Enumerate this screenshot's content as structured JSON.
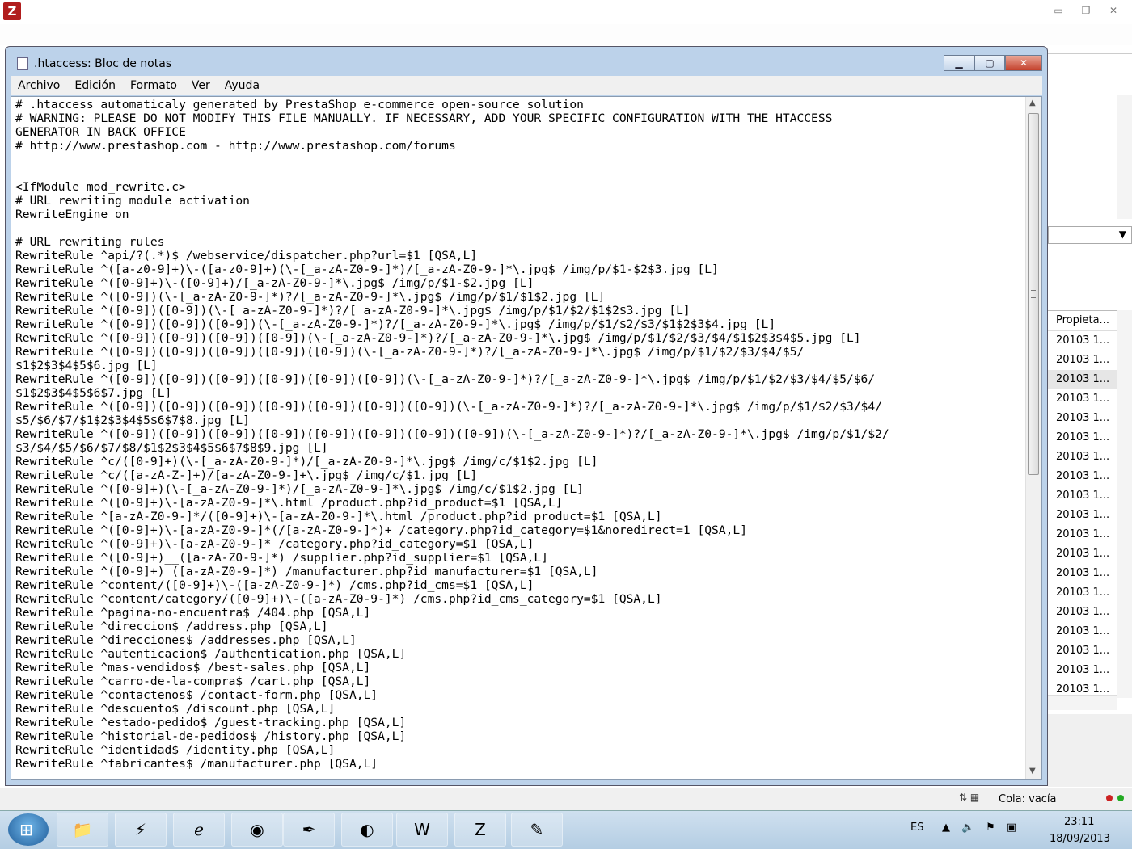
{
  "notepad": {
    "title": ".htaccess: Bloc de notas",
    "menu": [
      "Archivo",
      "Edición",
      "Formato",
      "Ver",
      "Ayuda"
    ],
    "content": "# .htaccess automaticaly generated by PrestaShop e-commerce open-source solution\n# WARNING: PLEASE DO NOT MODIFY THIS FILE MANUALLY. IF NECESSARY, ADD YOUR SPECIFIC CONFIGURATION WITH THE HTACCESS\nGENERATOR IN BACK OFFICE\n# http://www.prestashop.com - http://www.prestashop.com/forums\n\n\n<IfModule mod_rewrite.c>\n# URL rewriting module activation\nRewriteEngine on\n\n# URL rewriting rules\nRewriteRule ^api/?(.*)$ /webservice/dispatcher.php?url=$1 [QSA,L]\nRewriteRule ^([a-z0-9]+)\\-([a-z0-9]+)(\\-[_a-zA-Z0-9-]*)/[_a-zA-Z0-9-]*\\.jpg$ /img/p/$1-$2$3.jpg [L]\nRewriteRule ^([0-9]+)\\-([0-9]+)/[_a-zA-Z0-9-]*\\.jpg$ /img/p/$1-$2.jpg [L]\nRewriteRule ^([0-9])(\\-[_a-zA-Z0-9-]*)?/[_a-zA-Z0-9-]*\\.jpg$ /img/p/$1/$1$2.jpg [L]\nRewriteRule ^([0-9])([0-9])(\\-[_a-zA-Z0-9-]*)?/[_a-zA-Z0-9-]*\\.jpg$ /img/p/$1/$2/$1$2$3.jpg [L]\nRewriteRule ^([0-9])([0-9])([0-9])(\\-[_a-zA-Z0-9-]*)?/[_a-zA-Z0-9-]*\\.jpg$ /img/p/$1/$2/$3/$1$2$3$4.jpg [L]\nRewriteRule ^([0-9])([0-9])([0-9])([0-9])(\\-[_a-zA-Z0-9-]*)?/[_a-zA-Z0-9-]*\\.jpg$ /img/p/$1/$2/$3/$4/$1$2$3$4$5.jpg [L]\nRewriteRule ^([0-9])([0-9])([0-9])([0-9])([0-9])(\\-[_a-zA-Z0-9-]*)?/[_a-zA-Z0-9-]*\\.jpg$ /img/p/$1/$2/$3/$4/$5/\n$1$2$3$4$5$6.jpg [L]\nRewriteRule ^([0-9])([0-9])([0-9])([0-9])([0-9])([0-9])(\\-[_a-zA-Z0-9-]*)?/[_a-zA-Z0-9-]*\\.jpg$ /img/p/$1/$2/$3/$4/$5/$6/\n$1$2$3$4$5$6$7.jpg [L]\nRewriteRule ^([0-9])([0-9])([0-9])([0-9])([0-9])([0-9])([0-9])(\\-[_a-zA-Z0-9-]*)?/[_a-zA-Z0-9-]*\\.jpg$ /img/p/$1/$2/$3/$4/\n$5/$6/$7/$1$2$3$4$5$6$7$8.jpg [L]\nRewriteRule ^([0-9])([0-9])([0-9])([0-9])([0-9])([0-9])([0-9])([0-9])(\\-[_a-zA-Z0-9-]*)?/[_a-zA-Z0-9-]*\\.jpg$ /img/p/$1/$2/\n$3/$4/$5/$6/$7/$8/$1$2$3$4$5$6$7$8$9.jpg [L]\nRewriteRule ^c/([0-9]+)(\\-[_a-zA-Z0-9-]*)/[_a-zA-Z0-9-]*\\.jpg$ /img/c/$1$2.jpg [L]\nRewriteRule ^c/([a-zA-Z-]+)/[a-zA-Z0-9-]+\\.jpg$ /img/c/$1.jpg [L]\nRewriteRule ^([0-9]+)(\\-[_a-zA-Z0-9-]*)/[_a-zA-Z0-9-]*\\.jpg$ /img/c/$1$2.jpg [L]\nRewriteRule ^([0-9]+)\\-[a-zA-Z0-9-]*\\.html /product.php?id_product=$1 [QSA,L]\nRewriteRule ^[a-zA-Z0-9-]*/([0-9]+)\\-[a-zA-Z0-9-]*\\.html /product.php?id_product=$1 [QSA,L]\nRewriteRule ^([0-9]+)\\-[a-zA-Z0-9-]*(/[a-zA-Z0-9-]*)+ /category.php?id_category=$1&noredirect=1 [QSA,L]\nRewriteRule ^([0-9]+)\\-[a-zA-Z0-9-]* /category.php?id_category=$1 [QSA,L]\nRewriteRule ^([0-9]+)__([a-zA-Z0-9-]*) /supplier.php?id_supplier=$1 [QSA,L]\nRewriteRule ^([0-9]+)_([a-zA-Z0-9-]*) /manufacturer.php?id_manufacturer=$1 [QSA,L]\nRewriteRule ^content/([0-9]+)\\-([a-zA-Z0-9-]*) /cms.php?id_cms=$1 [QSA,L]\nRewriteRule ^content/category/([0-9]+)\\-([a-zA-Z0-9-]*) /cms.php?id_cms_category=$1 [QSA,L]\nRewriteRule ^pagina-no-encuentra$ /404.php [QSA,L]\nRewriteRule ^direccion$ /address.php [QSA,L]\nRewriteRule ^direcciones$ /addresses.php [QSA,L]\nRewriteRule ^autenticacion$ /authentication.php [QSA,L]\nRewriteRule ^mas-vendidos$ /best-sales.php [QSA,L]\nRewriteRule ^carro-de-la-compra$ /cart.php [QSA,L]\nRewriteRule ^contactenos$ /contact-form.php [QSA,L]\nRewriteRule ^descuento$ /discount.php [QSA,L]\nRewriteRule ^estado-pedido$ /guest-tracking.php [QSA,L]\nRewriteRule ^historial-de-pedidos$ /history.php [QSA,L]\nRewriteRule ^identidad$ /identity.php [QSA,L]\nRewriteRule ^fabricantes$ /manufacturer.php [QSA,L]"
  },
  "filezilla": {
    "app_icon_letter": "Z",
    "list_header": "Propieta...",
    "list_rows": [
      "20103 1...",
      "20103 1...",
      "20103 1...",
      "20103 1...",
      "20103 1...",
      "20103 1...",
      "20103 1...",
      "20103 1...",
      "20103 1...",
      "20103 1...",
      "20103 1...",
      "20103 1...",
      "20103 1...",
      "20103 1...",
      "20103 1...",
      "20103 1...",
      "20103 1...",
      "20103 1...",
      "20103 1..."
    ],
    "queue_status": "Cola: vacía"
  },
  "taskbar": {
    "language": "ES",
    "time": "23:11",
    "date": "18/09/2013"
  },
  "colors": {
    "notepad_frame": "#bcd2ea",
    "close_button": "#c4412c",
    "filezilla_red": "#b11d1d",
    "led_red": "#cc2222",
    "led_green": "#22aa22"
  }
}
